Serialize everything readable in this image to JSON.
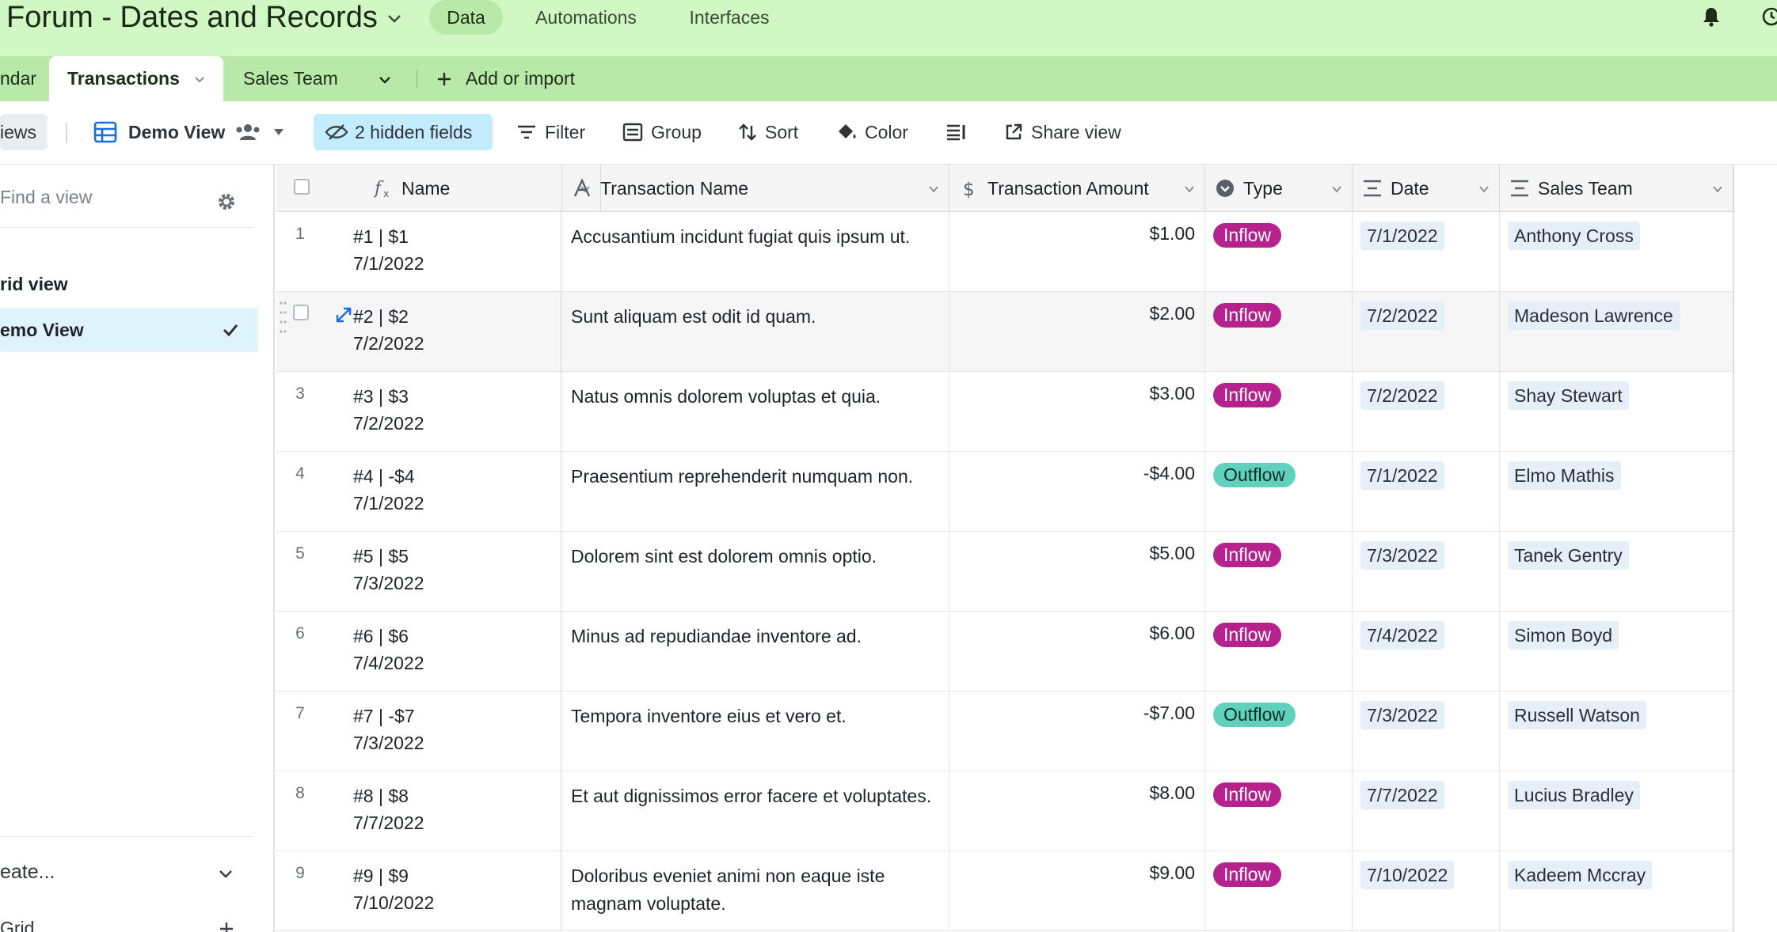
{
  "app": {
    "base_title": "Forum - Dates and Records",
    "nav": [
      "Data",
      "Automations",
      "Interfaces"
    ],
    "active_nav": "Data"
  },
  "tables": {
    "tabs": [
      "ndar",
      "Transactions",
      "Sales Team"
    ],
    "active_tab": "Transactions",
    "add_label": "Add or import"
  },
  "viewbar": {
    "views_label": "iews",
    "current_view": "Demo View",
    "hidden_fields": "2 hidden fields",
    "filter": "Filter",
    "group": "Group",
    "sort": "Sort",
    "color": "Color",
    "share": "Share view"
  },
  "sidebar": {
    "search_placeholder": "Find a view",
    "views": [
      "rid view",
      "emo View"
    ],
    "active_view": "emo View",
    "create_label": "eate...",
    "create_grid": "Grid"
  },
  "grid": {
    "columns": [
      "Name",
      "Transaction Name",
      "Transaction Amount",
      "Type",
      "Date",
      "Sales Team"
    ],
    "rows": [
      {
        "num": "1",
        "name1": "#1 | $1",
        "name2": "7/1/2022",
        "tx": "Accusantium incidunt fugiat quis ipsum ut.",
        "amount": "$1.00",
        "type": "Inflow",
        "date": "7/1/2022",
        "team": "Anthony Cross"
      },
      {
        "num": "2",
        "name1": "#2 | $2",
        "name2": "7/2/2022",
        "tx": "Sunt aliquam est odit id quam.",
        "amount": "$2.00",
        "type": "Inflow",
        "date": "7/2/2022",
        "team": "Madeson Lawrence"
      },
      {
        "num": "3",
        "name1": "#3 | $3",
        "name2": "7/2/2022",
        "tx": "Natus omnis dolorem voluptas et quia.",
        "amount": "$3.00",
        "type": "Inflow",
        "date": "7/2/2022",
        "team": "Shay Stewart"
      },
      {
        "num": "4",
        "name1": "#4 | -$4",
        "name2": "7/1/2022",
        "tx": "Praesentium reprehenderit numquam non.",
        "amount": "-$4.00",
        "type": "Outflow",
        "date": "7/1/2022",
        "team": "Elmo Mathis"
      },
      {
        "num": "5",
        "name1": "#5 | $5",
        "name2": "7/3/2022",
        "tx": "Dolorem sint est dolorem omnis optio.",
        "amount": "$5.00",
        "type": "Inflow",
        "date": "7/3/2022",
        "team": "Tanek Gentry"
      },
      {
        "num": "6",
        "name1": "#6 | $6",
        "name2": "7/4/2022",
        "tx": "Minus ad repudiandae inventore ad.",
        "amount": "$6.00",
        "type": "Inflow",
        "date": "7/4/2022",
        "team": "Simon Boyd"
      },
      {
        "num": "7",
        "name1": "#7 | -$7",
        "name2": "7/3/2022",
        "tx": "Tempora inventore eius et vero et.",
        "amount": "-$7.00",
        "type": "Outflow",
        "date": "7/3/2022",
        "team": "Russell Watson"
      },
      {
        "num": "8",
        "name1": "#8 | $8",
        "name2": "7/7/2022",
        "tx": "Et aut dignissimos error facere et voluptates.",
        "amount": "$8.00",
        "type": "Inflow",
        "date": "7/7/2022",
        "team": "Lucius Bradley"
      },
      {
        "num": "9",
        "name1": "#9 | $9",
        "name2": "7/10/2022",
        "tx": "Doloribus eveniet animi non eaque iste magnam voluptate.",
        "amount": "$9.00",
        "type": "Inflow",
        "date": "7/10/2022",
        "team": "Kadeem Mccray"
      }
    ]
  },
  "colors": {
    "topbar": "#d1f7c4",
    "tabbar": "#b8e9a8",
    "inflow": "#b5228d",
    "outflow": "#5fd1bc",
    "accent_blue": "#166ee1"
  }
}
